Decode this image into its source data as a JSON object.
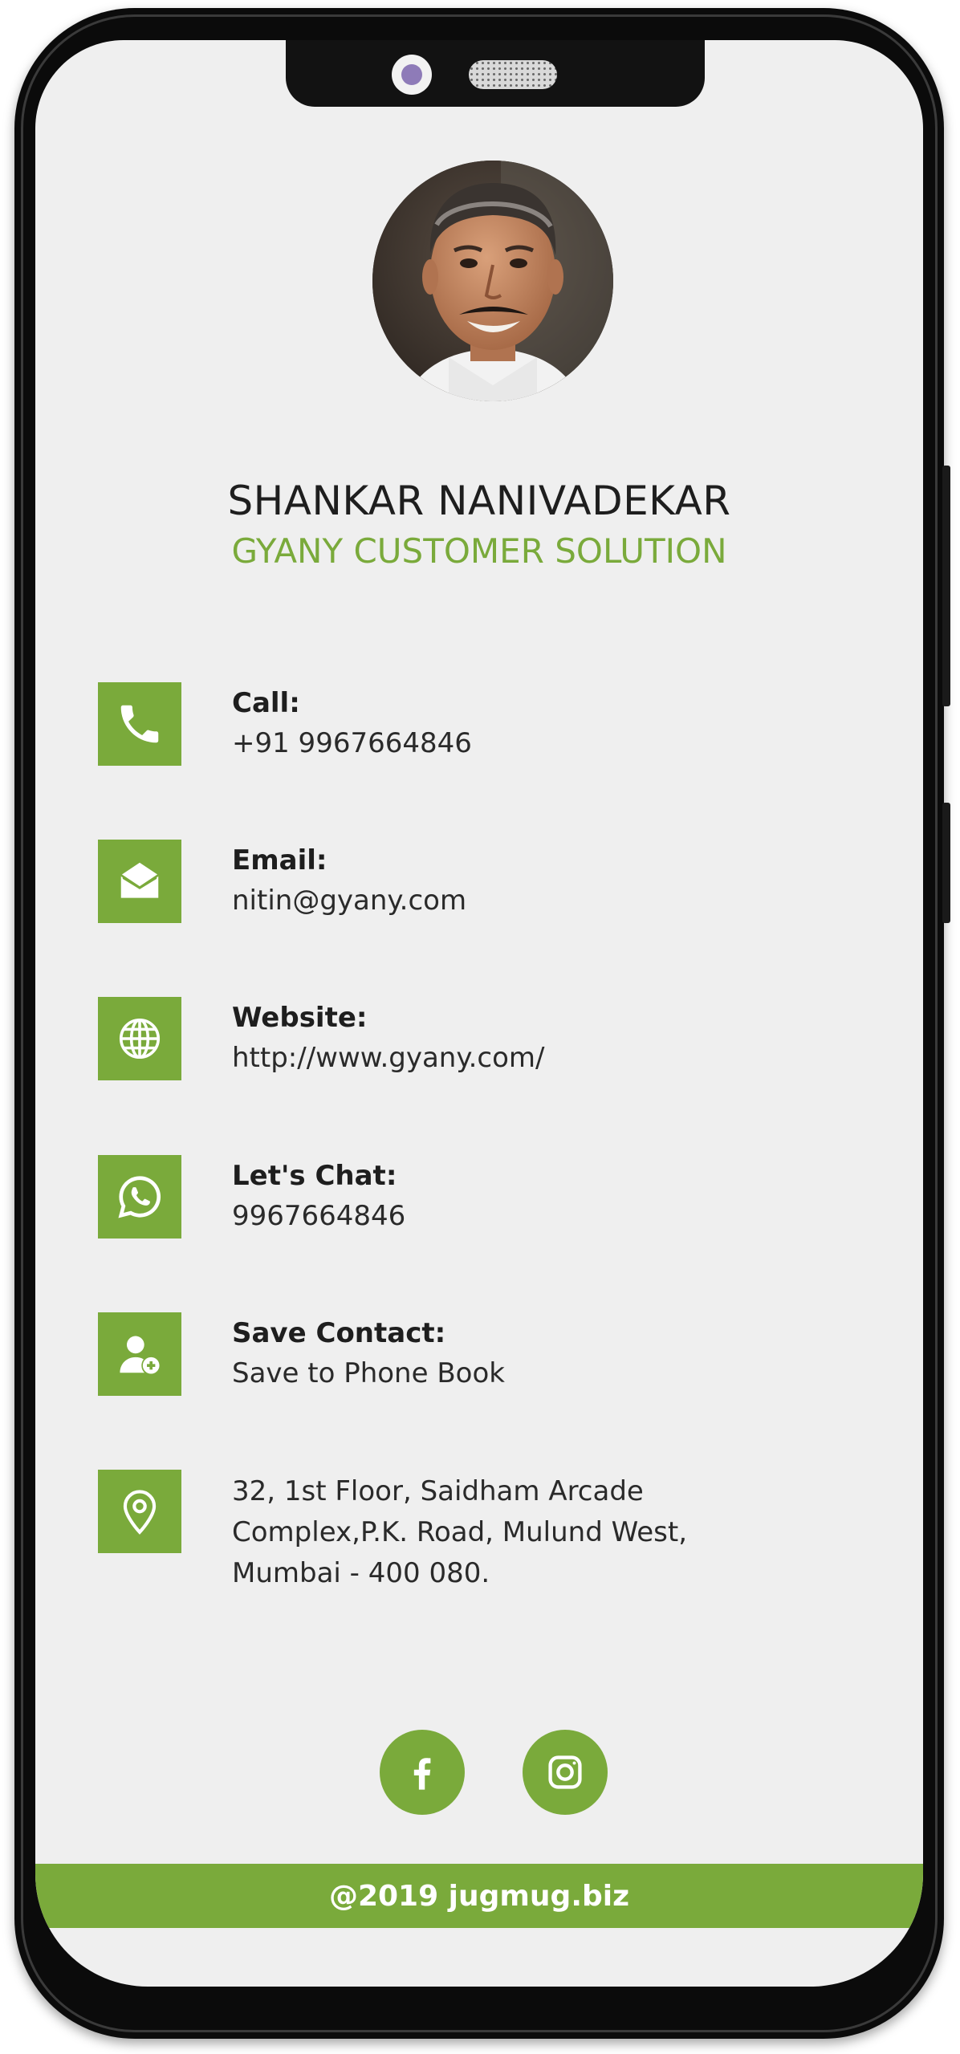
{
  "profile": {
    "name": "SHANKAR NANIVADEKAR",
    "company": "GYANY CUSTOMER SOLUTION"
  },
  "contacts": [
    {
      "icon": "phone-icon",
      "label": "Call:",
      "value": "+91 9967664846"
    },
    {
      "icon": "envelope-icon",
      "label": "Email:",
      "value": "nitin@gyany.com"
    },
    {
      "icon": "globe-icon",
      "label": "Website:",
      "value": "http://www.gyany.com/"
    },
    {
      "icon": "whatsapp-icon",
      "label": "Let's Chat:",
      "value": "9967664846"
    },
    {
      "icon": "add-user-icon",
      "label": "Save Contact:",
      "value": "Save to Phone Book"
    }
  ],
  "address": {
    "icon": "map-pin-icon",
    "lines": [
      "32, 1st Floor, Saidham Arcade",
      "Complex,P.K. Road, Mulund West,",
      "Mumbai - 400 080."
    ]
  },
  "social": [
    {
      "icon": "facebook-icon"
    },
    {
      "icon": "instagram-icon"
    }
  ],
  "footer": {
    "text": "@2019 jugmug.biz"
  },
  "colors": {
    "accent": "#7aaa3b",
    "background": "#efefef",
    "text": "#1e1e1e"
  }
}
